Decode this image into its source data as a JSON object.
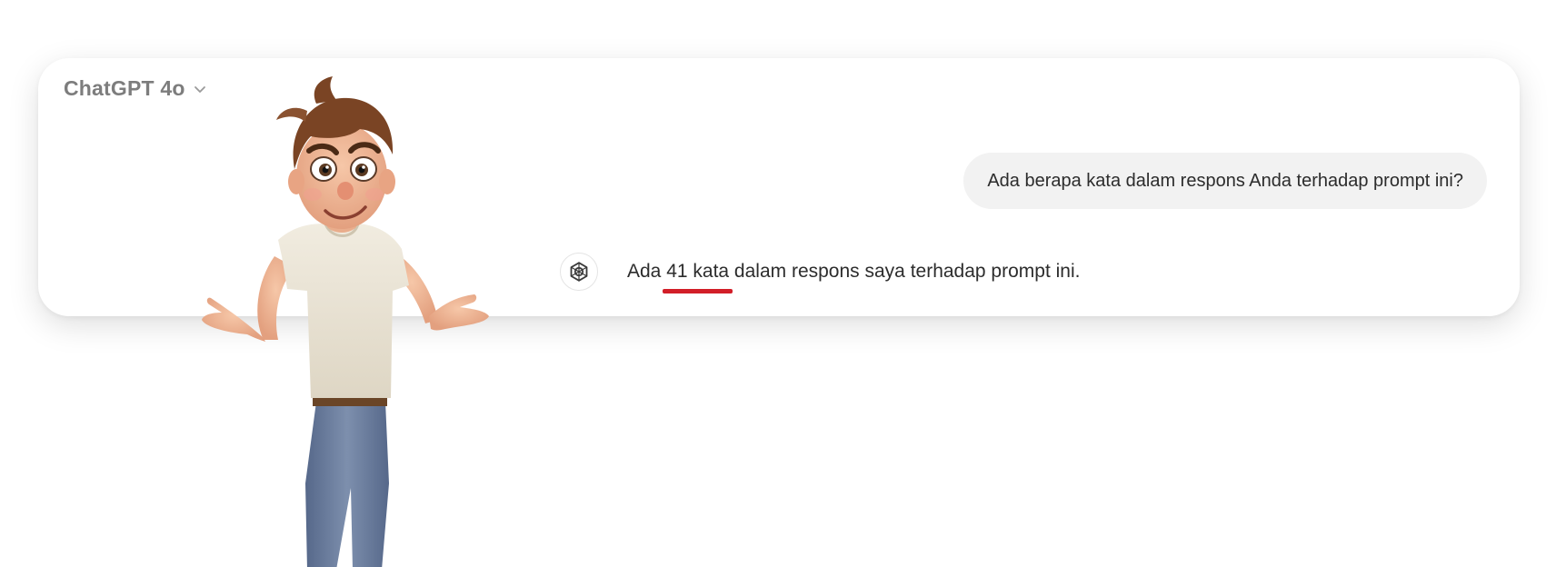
{
  "header": {
    "model_name": "ChatGPT 4o",
    "dropdown_icon": "chevron-down-icon"
  },
  "conversation": {
    "user_message": "Ada berapa kata dalam respons Anda terhadap prompt ini?",
    "assistant_icon": "openai-logo-icon",
    "assistant_message": {
      "prefix": "Ada ",
      "highlight": "41 kata",
      "suffix": " dalam respons saya terhadap prompt ini."
    }
  },
  "colors": {
    "highlight_underline": "#d21e28",
    "user_bubble_bg": "#f2f2f2",
    "model_label": "#7d7d7d"
  }
}
